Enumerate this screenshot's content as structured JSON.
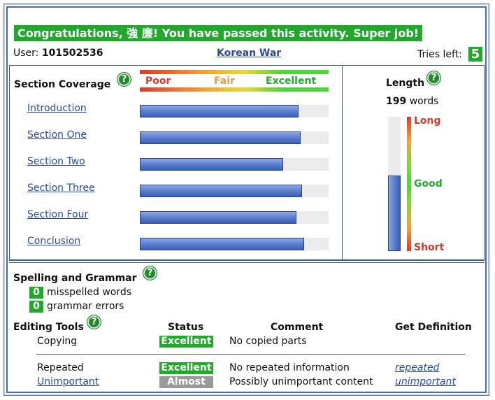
{
  "banner": "Congratulations, 強 廉! You have passed this activity.  Super job!",
  "user": {
    "label": "User:",
    "id": "101502536"
  },
  "topic": "Korean War",
  "tries": {
    "label": "Tries left:",
    "value": "5"
  },
  "coverage": {
    "title": "Section Coverage",
    "scale": {
      "poor": "Poor",
      "fair": "Fair",
      "excellent": "Excellent"
    },
    "sections": [
      {
        "label": "Introduction",
        "fill": 0.84
      },
      {
        "label": "Section One",
        "fill": 0.85
      },
      {
        "label": "Section Two",
        "fill": 0.76
      },
      {
        "label": "Section Three",
        "fill": 0.86
      },
      {
        "label": "Section Four",
        "fill": 0.83
      },
      {
        "label": "Conclusion",
        "fill": 0.87
      }
    ]
  },
  "length": {
    "title": "Length",
    "count": "199",
    "unit": "words",
    "fill": 0.56,
    "labels": {
      "long": "Long",
      "good": "Good",
      "short": "Short"
    }
  },
  "spelling": {
    "title": "Spelling and Grammar",
    "misspelled": {
      "count": "0",
      "label": "misspelled words"
    },
    "grammar": {
      "count": "0",
      "label": "grammar errors"
    }
  },
  "editing": {
    "title": "Editing Tools",
    "headers": {
      "status": "Status",
      "comment": "Comment",
      "definition": "Get Definition"
    },
    "rows": [
      {
        "tool": "Copying",
        "status": "Excellent",
        "comment": "No copied parts",
        "definition": ""
      },
      {
        "tool": "Repeated",
        "status": "Excellent",
        "comment": "No repeated information",
        "definition": "repeated"
      },
      {
        "tool": "Unimportant",
        "status": "Almost",
        "comment": "Possibly unimportant content",
        "definition": "unimportant"
      }
    ]
  },
  "colors": {
    "accent_green": "#22a82c",
    "link_blue": "#2b4c9b",
    "bar_blue": "#3b5fb5",
    "almost_gray": "#9a9a9a"
  },
  "help_icon_glyph": "?"
}
